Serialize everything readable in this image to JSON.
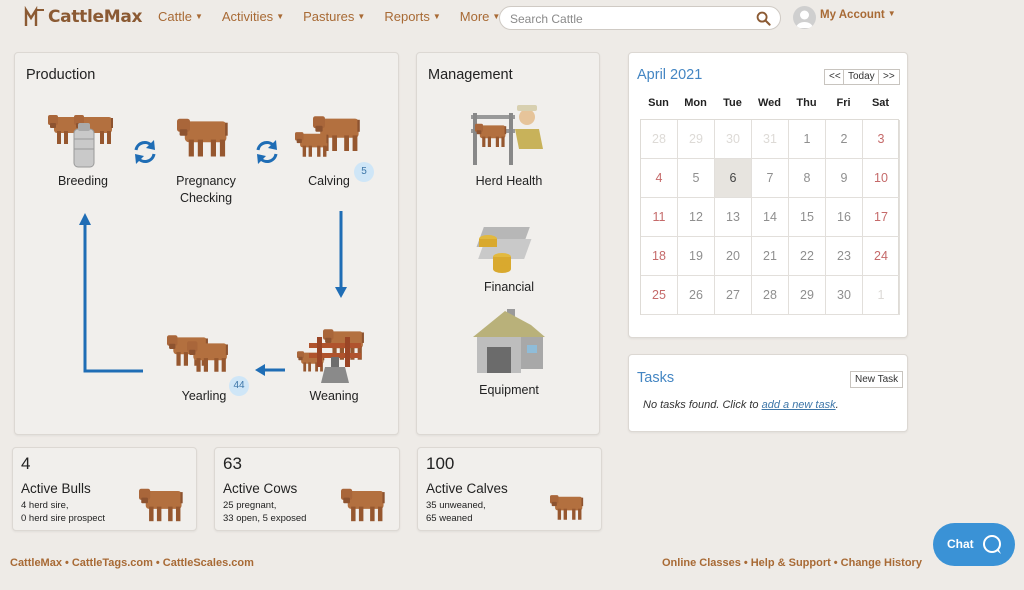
{
  "nav": {
    "logo_text": "CattleMax",
    "menu": [
      {
        "label": "Cattle"
      },
      {
        "label": "Activities"
      },
      {
        "label": "Pastures"
      },
      {
        "label": "Reports"
      },
      {
        "label": "More"
      }
    ],
    "search_placeholder": "Search Cattle",
    "account_label": "My Account"
  },
  "production": {
    "title": "Production",
    "breeding": "Breeding",
    "pregnancy_checking": "Pregnancy Checking",
    "calving": "Calving",
    "calving_count": "5",
    "weaning": "Weaning",
    "yearling": "Yearling",
    "yearling_count": "44"
  },
  "management": {
    "title": "Management",
    "herd_health": "Herd Health",
    "financial": "Financial",
    "equipment": "Equipment"
  },
  "calendar": {
    "title": "April 2021",
    "prev": "<<",
    "today": "Today",
    "next": ">>",
    "days_of_week": [
      "Sun",
      "Mon",
      "Tue",
      "Wed",
      "Thu",
      "Fri",
      "Sat"
    ],
    "weeks": [
      [
        "28",
        "29",
        "30",
        "31",
        "1",
        "2",
        "3"
      ],
      [
        "4",
        "5",
        "6",
        "7",
        "8",
        "9",
        "10"
      ],
      [
        "11",
        "12",
        "13",
        "14",
        "15",
        "16",
        "17"
      ],
      [
        "18",
        "19",
        "20",
        "21",
        "22",
        "23",
        "24"
      ],
      [
        "25",
        "26",
        "27",
        "28",
        "29",
        "30",
        "1"
      ]
    ]
  },
  "tasks": {
    "title": "Tasks",
    "new_task": "New Task",
    "empty_prefix": "No tasks found. Click to ",
    "empty_link": "add a new task",
    "empty_suffix": "."
  },
  "stats": {
    "bulls": {
      "count": "4",
      "label": "Active Bulls",
      "line1": "4 herd sire,",
      "line2": "0 herd sire prospect"
    },
    "cows": {
      "count": "63",
      "label": "Active Cows",
      "line1": "25 pregnant,",
      "line2": "33 open, 5 exposed"
    },
    "calves": {
      "count": "100",
      "label": "Active Calves",
      "line1": "35 unweaned,",
      "line2": "65 weaned"
    }
  },
  "footer": {
    "left": [
      "CattleMax",
      "CattleTags.com",
      "CattleScales.com"
    ],
    "right": [
      "Online Classes",
      "Help & Support",
      "Change History"
    ],
    "separator": "•"
  },
  "chat": {
    "label": "Chat"
  },
  "colors": {
    "brand": "#a86a35",
    "accent": "#3a92d6",
    "flow_arrow": "#1f6db5",
    "weekend": "#c56a6a"
  }
}
